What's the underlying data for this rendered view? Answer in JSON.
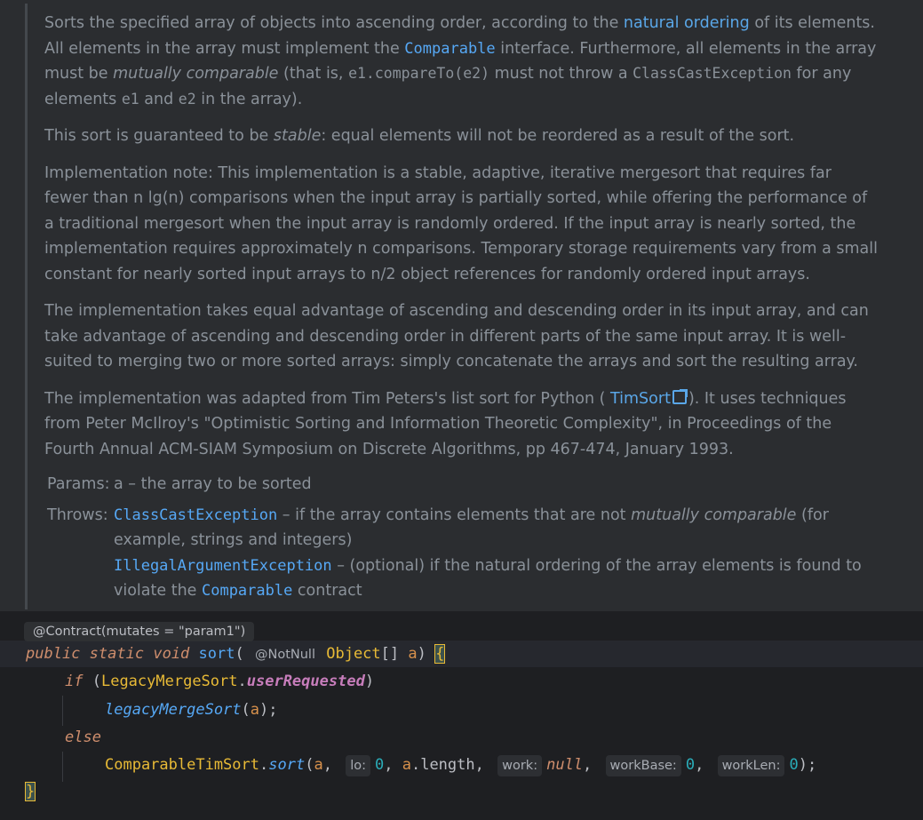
{
  "doc": {
    "para1": {
      "t1": "Sorts the specified array of objects into ascending order, according to the ",
      "link1": "natural ordering",
      "t2": " of its elements. All elements in the array must implement the ",
      "code1": "Comparable",
      "t3": " interface. Furthermore, all elements in the array must be ",
      "em1": "mutually comparable",
      "t4": " (that is, ",
      "code2": "e1.compareTo(e2)",
      "t5": " must not throw a ",
      "code3": "ClassCastException",
      "t6": " for any elements ",
      "code4": "e1",
      "t7": " and ",
      "code5": "e2",
      "t8": " in the array)."
    },
    "para2": {
      "t1": "This sort is guaranteed to be ",
      "em1": "stable",
      "t2": ": equal elements will not be reordered as a result of the sort."
    },
    "para3": "Implementation note: This implementation is a stable, adaptive, iterative mergesort that requires far fewer than n lg(n) comparisons when the input array is partially sorted, while offering the performance of a traditional mergesort when the input array is randomly ordered. If the input array is nearly sorted, the implementation requires approximately n comparisons. Temporary storage requirements vary from a small constant for nearly sorted input arrays to n/2 object references for randomly ordered input arrays.",
    "para4": "The implementation takes equal advantage of ascending and descending order in its input array, and can take advantage of ascending and descending order in different parts of the same input array. It is well-suited to merging two or more sorted arrays: simply concatenate the arrays and sort the resulting array.",
    "para5": {
      "t1": "The implementation was adapted from Tim Peters's list sort for Python ( ",
      "link1": "TimSort",
      "t2": "). It uses techniques from Peter McIlroy's \"Optimistic Sorting and Information Theoretic Complexity\", in Proceedings of the Fourth Annual ACM-SIAM Symposium on Discrete Algorithms, pp 467-474, January 1993."
    },
    "params": {
      "label": "Params:",
      "name": "a",
      "desc": " – the array to be sorted"
    },
    "throws": {
      "label": "Throws:",
      "items": [
        {
          "exc": "ClassCastException",
          "t1": " – if the array contains elements that are not ",
          "em": "mutually comparable",
          "t2": " (for example, strings and integers)"
        },
        {
          "exc": "IllegalArgumentException",
          "t1": " – (optional) if the natural ordering of the array elements is found to violate the ",
          "code": "Comparable",
          "t2": " contract"
        }
      ]
    }
  },
  "code": {
    "contract_hint": "@Contract(mutates = \"param1\")",
    "line1": {
      "kw1": "public",
      "kw2": "static",
      "kw3": "void",
      "fn": "sort",
      "open": "( ",
      "ann": "@NotNull",
      "type": "Object",
      "arr": "[] ",
      "param": "a",
      "close": ") ",
      "brace": "{"
    },
    "line2": {
      "kw": "if",
      "open": " (",
      "cls": "LegacyMergeSort",
      "dot": ".",
      "field": "userRequested",
      "close": ")"
    },
    "line3": {
      "fn": "legacyMergeSort",
      "open": "(",
      "param": "a",
      "close": ");"
    },
    "line4": {
      "kw": "else"
    },
    "line5": {
      "cls": "ComparableTimSort",
      "dot": ".",
      "fn": "sort",
      "open": "(",
      "a1": "a",
      "comma1": ", ",
      "hint_lo": "lo:",
      "num0": "0",
      "comma2": ", ",
      "a2": "a",
      "len": ".length",
      "comma3": ", ",
      "hint_work": "work:",
      "null": "null",
      "comma4": ", ",
      "hint_workbase": "workBase:",
      "num1": "0",
      "comma5": ", ",
      "hint_worklen": "workLen:",
      "num2": "0",
      "close": ");"
    },
    "line6": {
      "brace": "}"
    }
  },
  "colors": {
    "background": "#2b2d30",
    "editor_bg": "#1e1f22",
    "link": "#5aa7e8",
    "keyword": "#cf8e6d",
    "function": "#56a8f5",
    "class": "#e8ba36"
  }
}
